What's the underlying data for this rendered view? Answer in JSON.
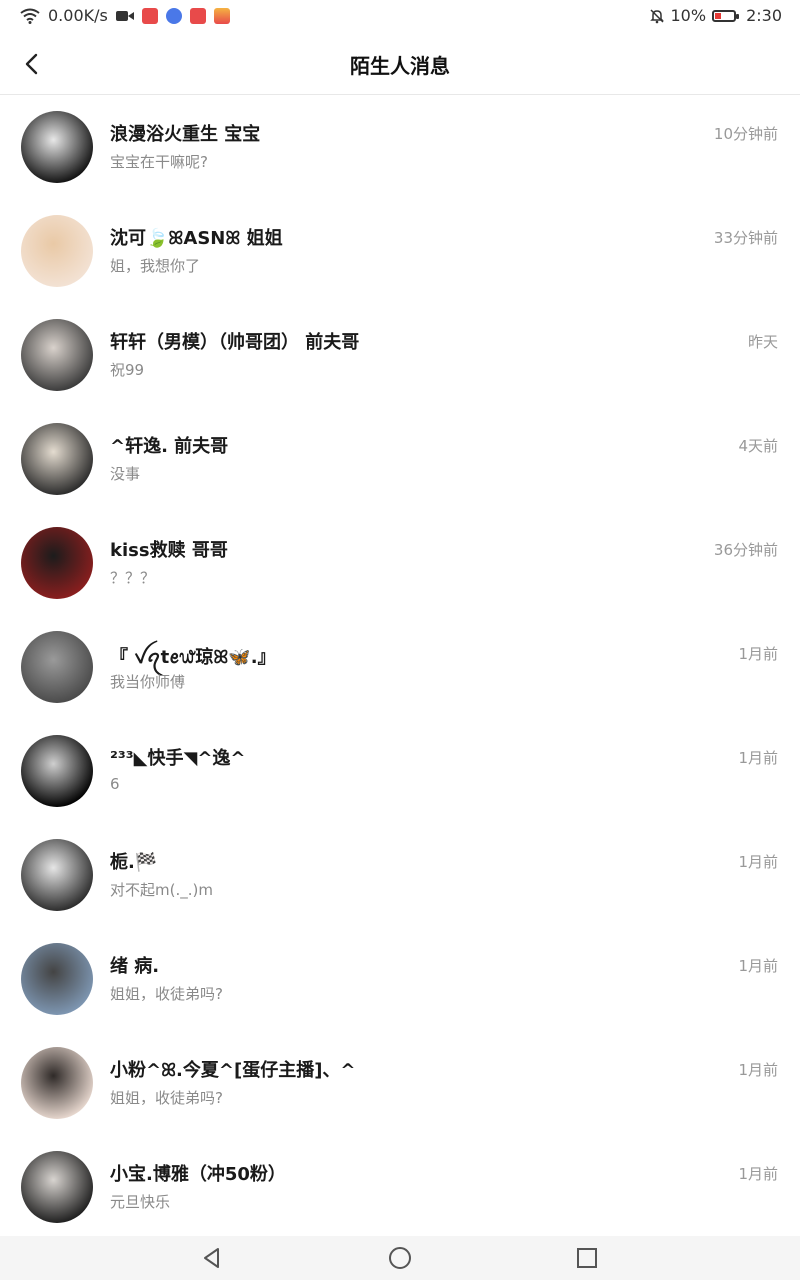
{
  "status_bar": {
    "net_speed": "0.00K/s",
    "battery_pct": "10%",
    "time": "2:30",
    "icons": [
      "wifi-icon",
      "video-icon",
      "app-badge-icon",
      "music-icon",
      "app-badge-icon",
      "app-badge-icon",
      "mute-bell-icon",
      "battery-icon"
    ]
  },
  "header": {
    "title": "陌生人消息"
  },
  "conversations": [
    {
      "name": "浪漫浴火重生  宝宝",
      "message": "宝宝在干嘛呢?",
      "time": "10分钟前",
      "avatar": "avatar-anime-boy",
      "colors": [
        "#111111",
        "#e8e8e8"
      ]
    },
    {
      "name": "沈可🍃ꕤASNꕤ  姐姐",
      "message": "姐，我想你了",
      "time": "33分钟前",
      "avatar": "avatar-doll",
      "colors": [
        "#f3e2d4",
        "#e9c9a6"
      ]
    },
    {
      "name": "轩轩（男模）（帅哥团）  前夫哥",
      "message": "祝99",
      "time": "昨天",
      "avatar": "avatar-boy-photo",
      "colors": [
        "#3a3a3a",
        "#d9d2cc"
      ]
    },
    {
      "name": "^轩逸. 前夫哥",
      "message": "没事",
      "time": "4天前",
      "avatar": "avatar-boy-sleep",
      "colors": [
        "#2a2a2a",
        "#e4dcd0"
      ]
    },
    {
      "name": "kiss救赎   哥哥",
      "message": "？？？",
      "time": "36分钟前",
      "avatar": "avatar-red-hair",
      "colors": [
        "#8b1e1e",
        "#1c1c1c"
      ]
    },
    {
      "name": "『 ꪜꪖtꫀ᭙琼ꕤ🦋.』",
      "message": "我当你师傅",
      "time": "1月前",
      "avatar": "avatar-dark-girl",
      "colors": [
        "#4a4a4a",
        "#9a9a9a"
      ]
    },
    {
      "name": "²³³◣快手◥^逸^",
      "message": "6",
      "time": "1月前",
      "avatar": "avatar-silhouette",
      "colors": [
        "#000000",
        "#cfcfcf"
      ]
    },
    {
      "name": "栀.🏁",
      "message": "对不起m(._.)m",
      "time": "1月前",
      "avatar": "avatar-glasses-girl",
      "colors": [
        "#2b2b2b",
        "#e6e6e6"
      ]
    },
    {
      "name": "绪 病.",
      "message": "姐姐，收徒弟吗?",
      "time": "1月前",
      "avatar": "avatar-street",
      "colors": [
        "#7e97b3",
        "#444444"
      ]
    },
    {
      "name": "小粉^ꕤ.今夏^[蛋仔主播]、^",
      "message": "姐姐，收徒弟吗?",
      "time": "1月前",
      "avatar": "avatar-pink-girl",
      "colors": [
        "#e8d8cf",
        "#2f2a28"
      ]
    },
    {
      "name": "小宝.博雅（冲50粉）",
      "message": "元旦快乐",
      "time": "1月前",
      "avatar": "avatar-long-hair",
      "colors": [
        "#1e1e1e",
        "#d8d4d0"
      ]
    }
  ]
}
